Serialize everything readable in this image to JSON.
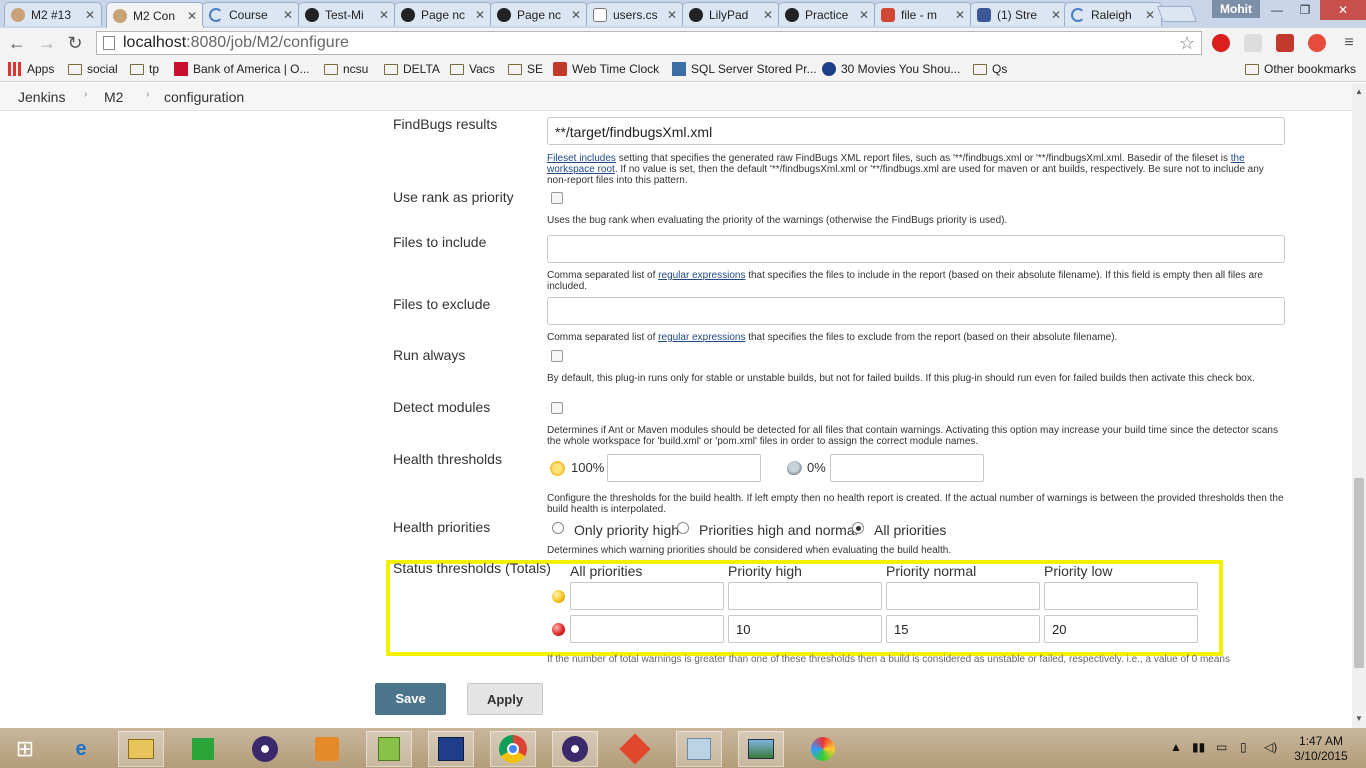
{
  "browser": {
    "tabs": [
      {
        "title": "M2 #13",
        "favicon": "jenkins-icon",
        "active": false
      },
      {
        "title": "M2 Con",
        "favicon": "jenkins-icon",
        "active": true
      },
      {
        "title": "Course",
        "favicon": "loading-icon",
        "active": false
      },
      {
        "title": "Test-Mi",
        "favicon": "github-icon",
        "active": false
      },
      {
        "title": "Page nc",
        "favicon": "github-icon",
        "active": false
      },
      {
        "title": "Page nc",
        "favicon": "github-icon",
        "active": false
      },
      {
        "title": "users.cs",
        "favicon": "spreadsheet-icon",
        "active": false
      },
      {
        "title": "LilyPad",
        "favicon": "github-icon",
        "active": false
      },
      {
        "title": "Practice",
        "favicon": "github-icon",
        "active": false
      },
      {
        "title": "file - m",
        "favicon": "gmail-icon",
        "active": false
      },
      {
        "title": "(1) Stre",
        "favicon": "facebook-icon",
        "active": false
      },
      {
        "title": "Raleigh",
        "favicon": "loading-icon",
        "active": false
      }
    ],
    "profile_name": "Mohit",
    "url_host": "localhost",
    "url_path": ":8080/job/M2/configure",
    "bookmarks": [
      {
        "label": "Apps",
        "icon": "apps-grid-icon"
      },
      {
        "label": "social",
        "icon": "folder-icon"
      },
      {
        "label": "tp",
        "icon": "folder-icon"
      },
      {
        "label": "Bank of America | O...",
        "icon": "bofa-icon"
      },
      {
        "label": "ncsu",
        "icon": "folder-icon"
      },
      {
        "label": "DELTA",
        "icon": "folder-icon"
      },
      {
        "label": "Vacs",
        "icon": "folder-icon"
      },
      {
        "label": "SE",
        "icon": "folder-icon"
      },
      {
        "label": "Web Time Clock",
        "icon": "webclock-icon"
      },
      {
        "label": "SQL Server Stored Pr...",
        "icon": "sql-icon"
      },
      {
        "label": "30 Movies You Shou...",
        "icon": "movie-icon"
      },
      {
        "label": "Qs",
        "icon": "folder-icon"
      }
    ],
    "other_bookmarks": "Other bookmarks"
  },
  "breadcrumbs": [
    "Jenkins",
    "M2",
    "configuration"
  ],
  "form": {
    "findbugs": {
      "label": "FindBugs results",
      "value": "**/target/findbugsXml.xml",
      "help_link1": "Fileset includes",
      "help_text1": " setting that specifies the generated raw FindBugs XML report files, such as '**/findbugs.xml or '**/findbugsXml.xml. Basedir of the fileset is ",
      "help_link2": "the workspace root",
      "help_text2": ". If no value is set, then the default '**/findbugsXml.xml or '**/findbugs.xml are used for maven or ant builds, respectively. Be sure not to include any non-report files into this pattern."
    },
    "use_rank": {
      "label": "Use rank as priority",
      "help": "Uses the bug rank when evaluating the priority of the warnings (otherwise the FindBugs priority is used)."
    },
    "files_include": {
      "label": "Files to include",
      "value": "",
      "help_prefix": "Comma separated list of ",
      "help_link": "regular expressions",
      "help_suffix": " that specifies the files to include in the report (based on their absolute filename). If this field is empty then all files are included."
    },
    "files_exclude": {
      "label": "Files to exclude",
      "value": "",
      "help_prefix": "Comma separated list of ",
      "help_link": "regular expressions",
      "help_suffix": " that specifies the files to exclude from the report (based on their absolute filename)."
    },
    "run_always": {
      "label": "Run always",
      "help": "By default, this plug-in runs only for stable or unstable builds, but not for failed builds. If this plug-in should run even for failed builds then activate this check box."
    },
    "detect_modules": {
      "label": "Detect modules",
      "help": "Determines if Ant or Maven modules should be detected for all files that contain warnings. Activating this option may increase your build time since the detector scans the whole workspace for 'build.xml' or 'pom.xml' files in order to assign the correct module names."
    },
    "health_thresholds": {
      "label": "Health thresholds",
      "healthy_pct": "100%",
      "unhealthy_pct": "0%",
      "healthy_value": "",
      "unhealthy_value": "",
      "help": "Configure the thresholds for the build health. If left empty then no health report is created. If the actual number of warnings is between the provided thresholds then the build health is interpolated."
    },
    "health_priorities": {
      "label": "Health priorities",
      "options": [
        "Only priority high",
        "Priorities high and normal",
        "All priorities"
      ],
      "selected": "All priorities",
      "help": "Determines which warning priorities should be considered when evaluating the build health."
    },
    "status_thresholds": {
      "label": "Status thresholds (Totals)",
      "columns": [
        "All priorities",
        "Priority high",
        "Priority normal",
        "Priority low"
      ],
      "unstable_values": [
        "",
        "",
        "",
        ""
      ],
      "failed_values": [
        "",
        "10",
        "15",
        "20"
      ],
      "help": "If the number of total warnings is greater than one of these thresholds then a build is considered as unstable or failed, respectively. i.e., a value of 0 means"
    },
    "save_label": "Save",
    "apply_label": "Apply"
  },
  "taskbar": {
    "time": "1:47 AM",
    "date": "3/10/2015"
  },
  "colors": {
    "highlight": "#f2f200",
    "save_button": "#4b758b",
    "link": "#204a87"
  }
}
